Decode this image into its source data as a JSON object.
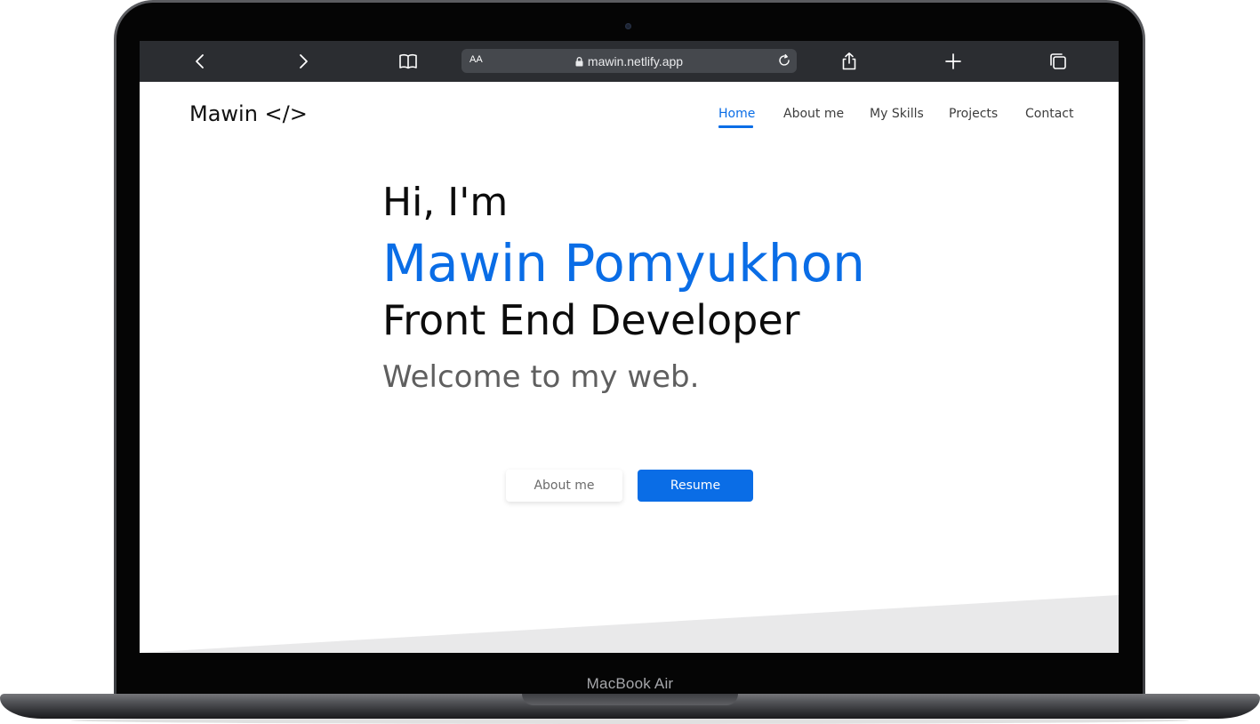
{
  "device": {
    "label": "MacBook Air"
  },
  "browser": {
    "text_size_label": "AA",
    "url": "mawin.netlify.app",
    "icons": {
      "back": "chevron-left-icon",
      "forward": "chevron-right-icon",
      "bookmarks": "book-icon",
      "lock": "lock-icon",
      "reload": "reload-icon",
      "share": "share-icon",
      "new_tab": "plus-icon",
      "tabs": "tabs-icon"
    }
  },
  "site": {
    "logo": "Mawin </>",
    "nav": [
      {
        "label": "Home",
        "active": true
      },
      {
        "label": "About me",
        "active": false
      },
      {
        "label": "My Skills",
        "active": false
      },
      {
        "label": "Projects",
        "active": false
      },
      {
        "label": "Contact",
        "active": false
      }
    ],
    "hero": {
      "greeting": "Hi, I'm",
      "name": "Mawin Pomyukhon",
      "role": "Front End Developer",
      "tagline": "Welcome to my web."
    },
    "buttons": {
      "about": "About me",
      "resume": "Resume"
    }
  },
  "colors": {
    "accent": "#0a6de6",
    "toolbar": "#2b2d31",
    "address_bar": "#45484d",
    "slant": "#e9e9ea"
  }
}
